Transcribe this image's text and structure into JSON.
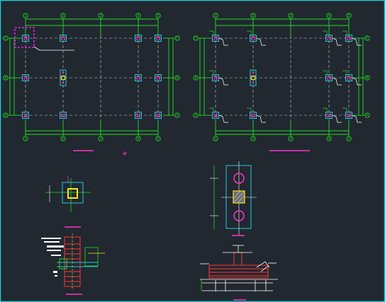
{
  "colors": {
    "background": "#212830",
    "viewport_border": "#27c7d8",
    "axis": "#22dd22",
    "grid_dash": "#cfcfcf",
    "column": "#27c7d8",
    "bolt": "#ff33cc",
    "leader": "#ffffff",
    "highlight": "#e020e0",
    "yellow": "#ffe21a",
    "rebar": "#ff3333",
    "hatch": "#c8c8c8"
  },
  "plan_left": {
    "columns": [
      "1",
      "2",
      "3",
      "4",
      "5"
    ],
    "rows": [
      "C",
      "B",
      "A"
    ]
  },
  "plan_right": {
    "columns": [
      "1",
      "2",
      "3",
      "4",
      "5"
    ],
    "rows": [
      "C",
      "B",
      "A"
    ]
  },
  "details": {
    "base_plate_plan": {},
    "base_section": {},
    "plate_elevation": {},
    "beam_section": {}
  }
}
